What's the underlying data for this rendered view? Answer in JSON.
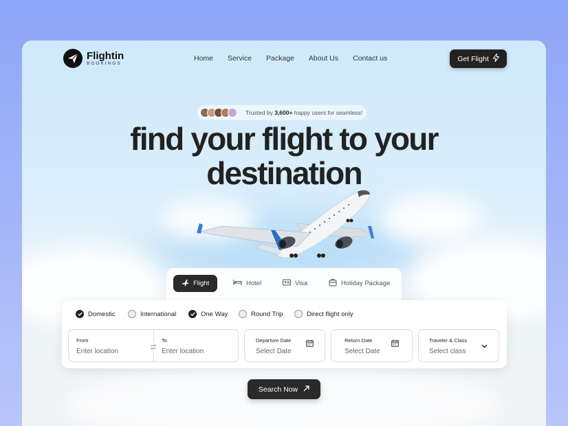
{
  "brand": {
    "name": "Flightin",
    "tagline": "BOOKINGS"
  },
  "nav": {
    "items": [
      "Home",
      "Service",
      "Package",
      "About Us",
      "Contact us"
    ]
  },
  "header": {
    "cta_label": "Get Flight",
    "cta_icon": "bolt-icon"
  },
  "trust": {
    "prefix": "Trusted by",
    "count": "3,600+",
    "suffix": "happy users for seamless!"
  },
  "hero": {
    "line1": "find your flight to your",
    "line2": "destination"
  },
  "tabs": [
    {
      "label": "Flight",
      "icon": "plane-icon",
      "active": true
    },
    {
      "label": "Hotel",
      "icon": "bed-icon",
      "active": false
    },
    {
      "label": "Visa",
      "icon": "id-card-icon",
      "active": false
    },
    {
      "label": "Holiday Package",
      "icon": "package-icon",
      "active": false
    }
  ],
  "options": [
    {
      "label": "Domestic",
      "checked": true
    },
    {
      "label": "International",
      "checked": false
    },
    {
      "label": "One Way",
      "checked": true
    },
    {
      "label": "Round Trip",
      "checked": false
    },
    {
      "label": "Direct flight only",
      "checked": false
    }
  ],
  "fields": {
    "from": {
      "label": "From",
      "placeholder": "Enter location"
    },
    "to": {
      "label": "To",
      "placeholder": "Enter location"
    },
    "departure": {
      "label": "Departure Date",
      "placeholder": "Select Date"
    },
    "return": {
      "label": "Return Date",
      "placeholder": "Select Date"
    },
    "traveler": {
      "label": "Traveler & Class",
      "placeholder": "Select class"
    }
  },
  "search": {
    "label": "Search Now"
  },
  "colors": {
    "accent": "#222222",
    "sky": "#cfe9fb",
    "page_bg": "#9fb2f8"
  }
}
